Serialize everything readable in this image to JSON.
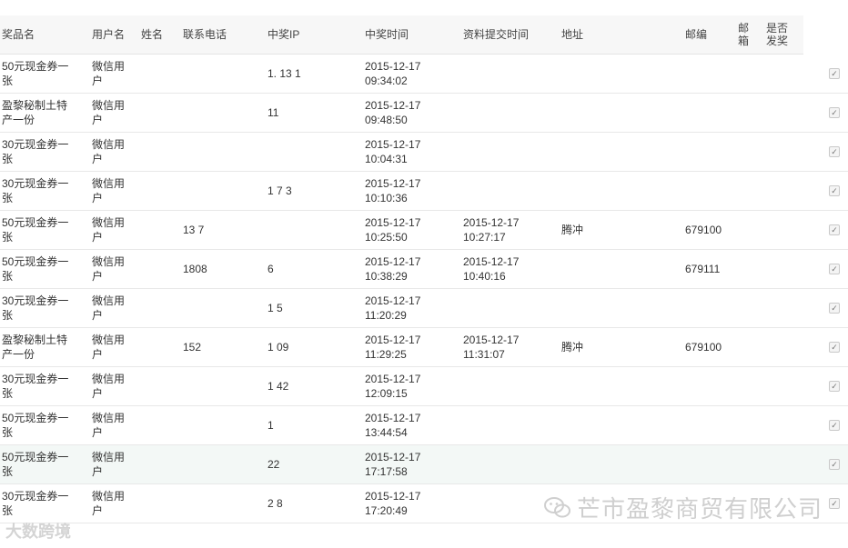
{
  "columns": {
    "prize": "奖品名",
    "username": "用户名",
    "name": "姓名",
    "phone": "联系电话",
    "ip": "中奖IP",
    "win_time": "中奖时间",
    "submit_time": "资料提交时间",
    "address": "地址",
    "zip": "邮编",
    "mail": "邮箱",
    "shipped": "是否发奖"
  },
  "rows": [
    {
      "prize": "50元现金券一张",
      "username": "微信用户",
      "name": "",
      "phone": "",
      "ip": "1.  13      1",
      "win_time": "2015-12-17 09:34:02",
      "submit_time": "",
      "address": "",
      "zip": "",
      "checked": "✓"
    },
    {
      "prize": "盈黎秘制土特产一份",
      "username": "微信用户",
      "name": "",
      "phone": "",
      "ip": "11",
      "win_time": "2015-12-17 09:48:50",
      "submit_time": "",
      "address": "",
      "zip": "",
      "checked": "✓"
    },
    {
      "prize": "30元现金券一张",
      "username": "微信用户",
      "name": "",
      "phone": "",
      "ip": "",
      "win_time": "2015-12-17 10:04:31",
      "submit_time": "",
      "address": "",
      "zip": "",
      "checked": "✓"
    },
    {
      "prize": "30元现金券一张",
      "username": "微信用户",
      "name": "",
      "phone": "",
      "ip": "1  7    3",
      "win_time": "2015-12-17 10:10:36",
      "submit_time": "",
      "address": "",
      "zip": "",
      "checked": "✓"
    },
    {
      "prize": "50元现金券一张",
      "username": "微信用户",
      "name": "",
      "phone": "13      7",
      "ip": "",
      "win_time": "2015-12-17 10:25:50",
      "submit_time": "2015-12-17 10:27:17",
      "address": "腾冲",
      "zip": "679100",
      "checked": "✓"
    },
    {
      "prize": "50元现金券一张",
      "username": "微信用户",
      "name": "",
      "phone": "1808",
      "ip": "6",
      "win_time": "2015-12-17 10:38:29",
      "submit_time": "2015-12-17 10:40:16",
      "address": "",
      "zip": "679111",
      "checked": "✓"
    },
    {
      "prize": "30元现金券一张",
      "username": "微信用户",
      "name": "",
      "phone": "",
      "ip": "1      5",
      "win_time": "2015-12-17 11:20:29",
      "submit_time": "",
      "address": "",
      "zip": "",
      "checked": "✓"
    },
    {
      "prize": "盈黎秘制土特产一份",
      "username": "微信用户",
      "name": "",
      "phone": "152",
      "ip": "1      09",
      "win_time": "2015-12-17 11:29:25",
      "submit_time": "2015-12-17 11:31:07",
      "address": "腾冲",
      "zip": "679100",
      "checked": "✓"
    },
    {
      "prize": "30元现金券一张",
      "username": "微信用户",
      "name": "",
      "phone": "",
      "ip": "1      42",
      "win_time": "2015-12-17 12:09:15",
      "submit_time": "",
      "address": "",
      "zip": "",
      "checked": "✓"
    },
    {
      "prize": "50元现金券一张",
      "username": "微信用户",
      "name": "",
      "phone": "",
      "ip": "1",
      "win_time": "2015-12-17 13:44:54",
      "submit_time": "",
      "address": "",
      "zip": "",
      "checked": "✓"
    },
    {
      "prize": "50元现金券一张",
      "username": "微信用户",
      "name": "",
      "phone": "",
      "ip": "22",
      "win_time": "2015-12-17 17:17:58",
      "submit_time": "",
      "address": "",
      "zip": "",
      "checked": "✓"
    },
    {
      "prize": "30元现金券一张",
      "username": "微信用户",
      "name": "",
      "phone": "",
      "ip": "2      8",
      "win_time": "2015-12-17 17:20:49",
      "submit_time": "",
      "address": "",
      "zip": "",
      "checked": "✓"
    }
  ],
  "watermark_left": "大数跨境",
  "watermark_right": "芒市盈黎商贸有限公司",
  "colors": {
    "header_bg": "#f7f7f7",
    "row_border": "#e8e8e8",
    "highlight_row": "#f3f8f6"
  }
}
